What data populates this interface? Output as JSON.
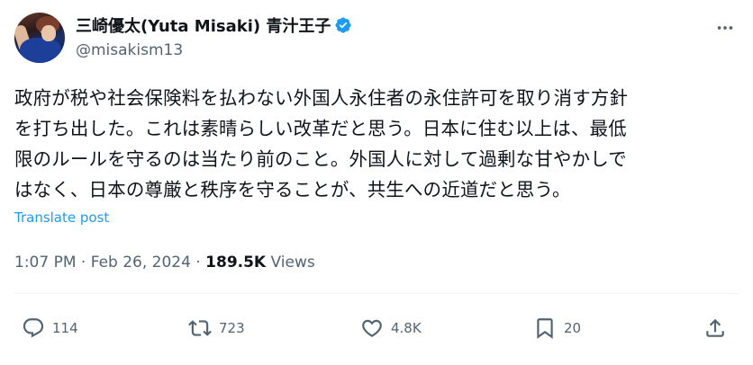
{
  "author": {
    "display_name": "三崎優太(Yuta Misaki) 青汁王子",
    "handle": "@misakism13"
  },
  "post": {
    "lines": [
      "政府が税や社会保険料を払わない外国人永住者の永住許可を取り消す方針",
      "を打ち出した。これは素晴らしい改革だと思う。日本に住む以上は、最低",
      "限のルールを守るのは当たり前のこと。外国人に対して過剰な甘やかしで",
      "はなく、日本の尊厳と秩序を守ることが、共生への近道だと思う。"
    ],
    "translate_label": "Translate post"
  },
  "meta": {
    "time": "1:07 PM",
    "date": "Feb 26, 2024",
    "views_count": "189.5K",
    "views_label": "Views",
    "separator": "·"
  },
  "actions": {
    "replies": "114",
    "reposts": "723",
    "likes": "4.8K",
    "bookmarks": "20"
  },
  "colors": {
    "accent": "#1d9bf0",
    "secondary_text": "#536471",
    "primary_text": "#0f1419"
  },
  "icons": [
    "verified-badge-icon",
    "more-icon",
    "reply-icon",
    "repost-icon",
    "like-icon",
    "bookmark-icon",
    "share-icon"
  ]
}
